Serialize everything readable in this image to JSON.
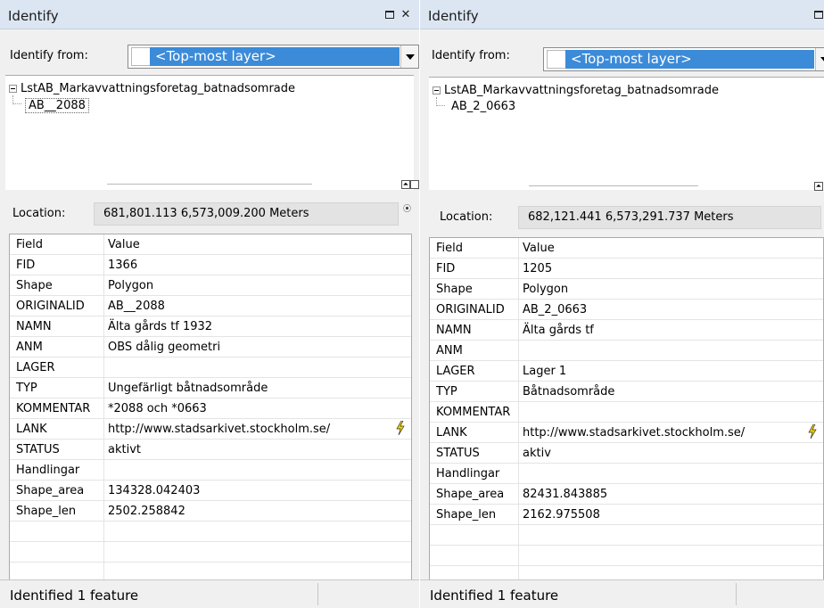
{
  "panels": [
    {
      "title": "Identify",
      "identify_from_label": "Identify from:",
      "identify_from_value": "<Top-most layer>",
      "tree": {
        "layer": "LstAB_Markavvattningsforetag_batnadsomrade",
        "feature": "AB__2088"
      },
      "location_label": "Location:",
      "location_value": "681,801.113  6,573,009.200 Meters",
      "table_headers": {
        "field": "Field",
        "value": "Value"
      },
      "rows": [
        {
          "field": "FID",
          "value": "1366"
        },
        {
          "field": "Shape",
          "value": "Polygon"
        },
        {
          "field": "ORIGINALID",
          "value": "AB__2088"
        },
        {
          "field": "NAMN",
          "value": "Älta gårds tf 1932"
        },
        {
          "field": "ANM",
          "value": "OBS dålig geometri"
        },
        {
          "field": "LAGER",
          "value": ""
        },
        {
          "field": "TYP",
          "value": "Ungefärligt båtnadsområde"
        },
        {
          "field": "KOMMENTAR",
          "value": "*2088 och *0663"
        },
        {
          "field": "LANK",
          "value": "http://www.stadsarkivet.stockholm.se/"
        },
        {
          "field": "STATUS",
          "value": "aktivt"
        },
        {
          "field": "Handlingar",
          "value": ""
        },
        {
          "field": "Shape_area",
          "value": "134328.042403"
        },
        {
          "field": "Shape_len",
          "value": "2502.258842"
        }
      ],
      "status": "Identified 1 feature"
    },
    {
      "title": "Identify",
      "identify_from_label": "Identify from:",
      "identify_from_value": "<Top-most layer>",
      "tree": {
        "layer": "LstAB_Markavvattningsforetag_batnadsomrade",
        "feature": "AB_2_0663"
      },
      "location_label": "Location:",
      "location_value": "682,121.441  6,573,291.737 Meters",
      "table_headers": {
        "field": "Field",
        "value": "Value"
      },
      "rows": [
        {
          "field": "FID",
          "value": "1205"
        },
        {
          "field": "Shape",
          "value": "Polygon"
        },
        {
          "field": "ORIGINALID",
          "value": "AB_2_0663"
        },
        {
          "field": "NAMN",
          "value": "Älta gårds tf"
        },
        {
          "field": "ANM",
          "value": ""
        },
        {
          "field": "LAGER",
          "value": "Lager 1"
        },
        {
          "field": "TYP",
          "value": "Båtnadsområde"
        },
        {
          "field": "KOMMENTAR",
          "value": ""
        },
        {
          "field": "LANK",
          "value": "http://www.stadsarkivet.stockholm.se/"
        },
        {
          "field": "STATUS",
          "value": "aktiv"
        },
        {
          "field": "Handlingar",
          "value": ""
        },
        {
          "field": "Shape_area",
          "value": "82431.843885"
        },
        {
          "field": "Shape_len",
          "value": "2162.975508"
        }
      ],
      "status": "Identified 1 feature"
    }
  ],
  "icons": {
    "close": "close-icon",
    "restore": "restore-icon",
    "hyperlink": "lightning-icon"
  },
  "colors": {
    "titlebar": "#dce6f2",
    "selection": "#3b8bd9",
    "window": "#f0f0f0",
    "link_icon": "#f0d000"
  }
}
